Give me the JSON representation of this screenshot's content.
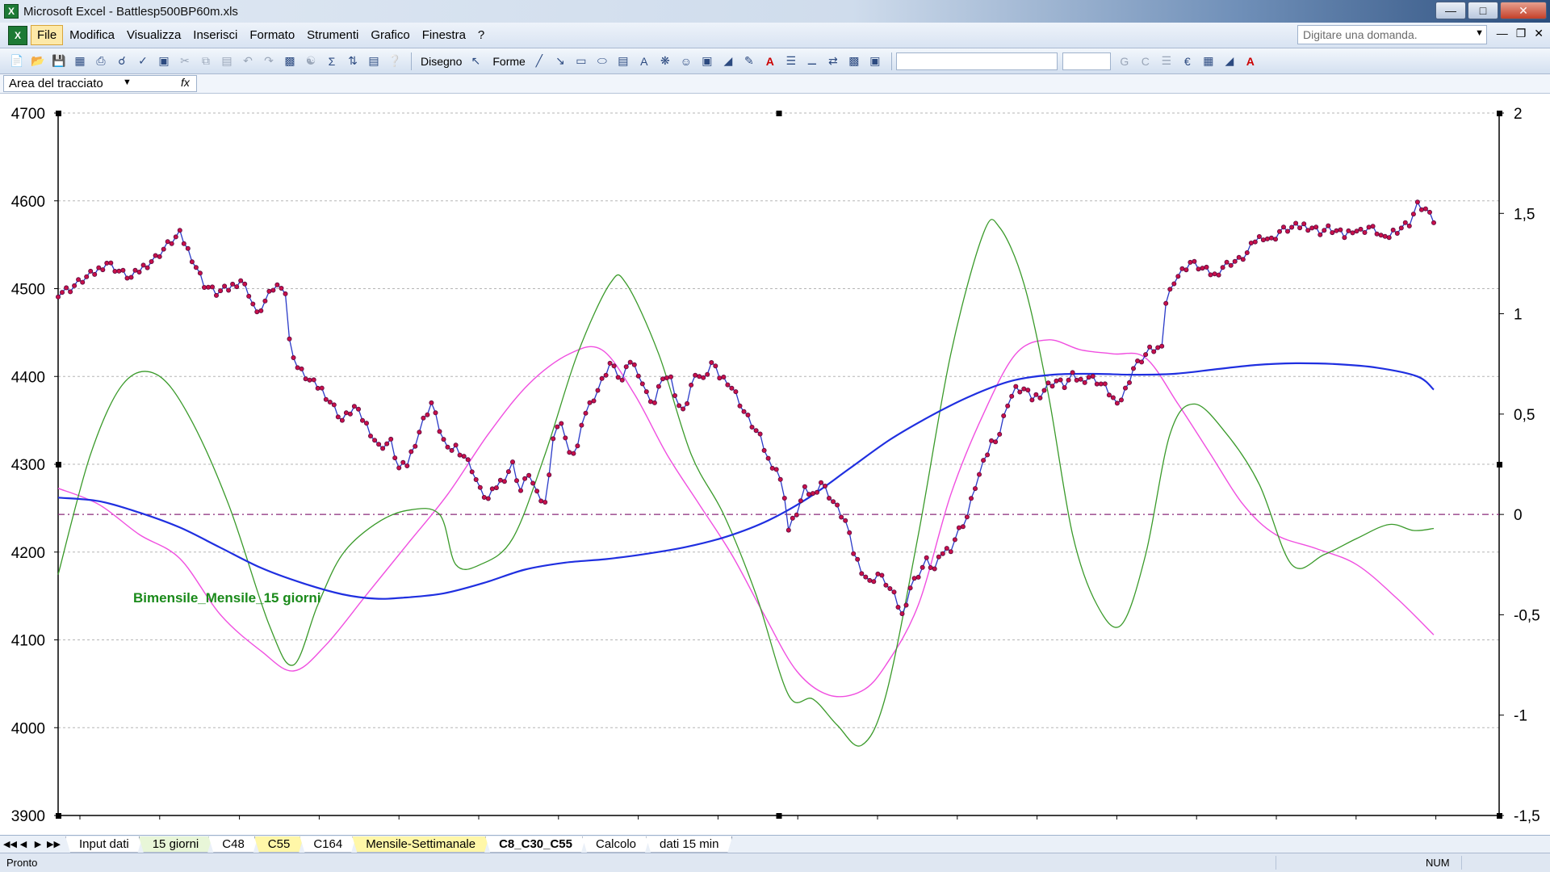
{
  "window": {
    "title": "Microsoft Excel - Battlesp500BP60m.xls",
    "app_icon": "X"
  },
  "menu": {
    "items": [
      "File",
      "Modifica",
      "Visualizza",
      "Inserisci",
      "Formato",
      "Strumenti",
      "Grafico",
      "Finestra",
      "?"
    ],
    "active_index": 0,
    "ask_placeholder": "Digitare una domanda."
  },
  "toolbar": {
    "draw_label": "Disegno",
    "shapes_label": "Forme",
    "bold_label": "G",
    "italic_label": "C",
    "currency_label": "€"
  },
  "namebox": {
    "value": "Area del tracciato",
    "fx": "fx"
  },
  "sheets": {
    "tabs": [
      {
        "label": "Input dati",
        "style": "plain"
      },
      {
        "label": "15 giorni",
        "style": "green"
      },
      {
        "label": "C48",
        "style": "plain"
      },
      {
        "label": "C55",
        "style": "yellow"
      },
      {
        "label": "C164",
        "style": "plain"
      },
      {
        "label": "Mensile-Settimanale",
        "style": "yellow"
      },
      {
        "label": "C8_C30_C55",
        "style": "active"
      },
      {
        "label": "Calcolo",
        "style": "plain"
      },
      {
        "label": "dati 15 min",
        "style": "plain"
      }
    ]
  },
  "status": {
    "text": "Pronto",
    "num": "NUM"
  },
  "chart_data": {
    "type": "line",
    "annotation": "Bimensile_Mensile_15 giorni",
    "grid": true,
    "y_left": {
      "min": 3900,
      "max": 4700,
      "ticks": [
        "4700",
        "4600",
        "4500",
        "4400",
        "4300",
        "4200",
        "4100",
        "4000",
        "3900"
      ]
    },
    "y_right": {
      "min": -1.5,
      "max": 2,
      "ticks": [
        "2",
        "1,5",
        "1",
        "0,5",
        "0",
        "-0,5",
        "-1",
        "-1,5"
      ]
    },
    "colors": {
      "price": "#7b1f6e",
      "price_markers": "#c8104a",
      "blue": "#1f2fe0",
      "green": "#3a9a2a",
      "magenta": "#f04fe0",
      "zero_line": "#8a2a7a",
      "annotation": "#1a8a1a"
    },
    "price": {
      "axis": "left",
      "anchors": [
        [
          0,
          4495
        ],
        [
          3,
          4500
        ],
        [
          6,
          4510
        ],
        [
          9,
          4518
        ],
        [
          12,
          4530
        ],
        [
          15,
          4520
        ],
        [
          18,
          4512
        ],
        [
          21,
          4525
        ],
        [
          24,
          4535
        ],
        [
          27,
          4550
        ],
        [
          30,
          4562
        ],
        [
          33,
          4535
        ],
        [
          36,
          4505
        ],
        [
          39,
          4495
        ],
        [
          42,
          4500
        ],
        [
          45,
          4510
        ],
        [
          47,
          4495
        ],
        [
          49,
          4470
        ],
        [
          51,
          4485
        ],
        [
          53,
          4500
        ],
        [
          55,
          4505
        ],
        [
          56,
          4495
        ],
        [
          57,
          4440
        ],
        [
          59,
          4410
        ],
        [
          62,
          4395
        ],
        [
          65,
          4385
        ],
        [
          68,
          4365
        ],
        [
          70,
          4350
        ],
        [
          73,
          4365
        ],
        [
          76,
          4345
        ],
        [
          79,
          4320
        ],
        [
          82,
          4325
        ],
        [
          84,
          4295
        ],
        [
          86,
          4300
        ],
        [
          88,
          4325
        ],
        [
          90,
          4350
        ],
        [
          92,
          4370
        ],
        [
          94,
          4340
        ],
        [
          96,
          4315
        ],
        [
          98,
          4320
        ],
        [
          100,
          4310
        ],
        [
          102,
          4295
        ],
        [
          104,
          4270
        ],
        [
          106,
          4260
        ],
        [
          108,
          4275
        ],
        [
          110,
          4285
        ],
        [
          112,
          4300
        ],
        [
          114,
          4270
        ],
        [
          116,
          4290
        ],
        [
          118,
          4265
        ],
        [
          120,
          4255
        ],
        [
          122,
          4330
        ],
        [
          124,
          4350
        ],
        [
          126,
          4310
        ],
        [
          128,
          4320
        ],
        [
          130,
          4360
        ],
        [
          133,
          4385
        ],
        [
          136,
          4415
        ],
        [
          139,
          4395
        ],
        [
          141,
          4418
        ],
        [
          143,
          4405
        ],
        [
          145,
          4380
        ],
        [
          147,
          4370
        ],
        [
          149,
          4400
        ],
        [
          151,
          4395
        ],
        [
          153,
          4365
        ],
        [
          155,
          4370
        ],
        [
          157,
          4405
        ],
        [
          159,
          4395
        ],
        [
          161,
          4415
        ],
        [
          163,
          4400
        ],
        [
          165,
          4395
        ],
        [
          167,
          4380
        ],
        [
          169,
          4360
        ],
        [
          171,
          4345
        ],
        [
          173,
          4330
        ],
        [
          175,
          4305
        ],
        [
          177,
          4295
        ],
        [
          179,
          4265
        ],
        [
          180,
          4225
        ],
        [
          182,
          4245
        ],
        [
          184,
          4270
        ],
        [
          186,
          4265
        ],
        [
          188,
          4280
        ],
        [
          190,
          4265
        ],
        [
          192,
          4250
        ],
        [
          194,
          4235
        ],
        [
          196,
          4200
        ],
        [
          198,
          4180
        ],
        [
          200,
          4165
        ],
        [
          202,
          4175
        ],
        [
          204,
          4165
        ],
        [
          206,
          4150
        ],
        [
          208,
          4128
        ],
        [
          210,
          4160
        ],
        [
          212,
          4175
        ],
        [
          214,
          4190
        ],
        [
          216,
          4180
        ],
        [
          218,
          4200
        ],
        [
          220,
          4205
        ],
        [
          222,
          4225
        ],
        [
          224,
          4240
        ],
        [
          226,
          4275
        ],
        [
          228,
          4300
        ],
        [
          230,
          4325
        ],
        [
          232,
          4335
        ],
        [
          234,
          4370
        ],
        [
          236,
          4385
        ],
        [
          238,
          4385
        ],
        [
          240,
          4375
        ],
        [
          242,
          4380
        ],
        [
          244,
          4390
        ],
        [
          246,
          4395
        ],
        [
          248,
          4390
        ],
        [
          250,
          4400
        ],
        [
          252,
          4395
        ],
        [
          254,
          4400
        ],
        [
          256,
          4395
        ],
        [
          258,
          4388
        ],
        [
          260,
          4375
        ],
        [
          261,
          4365
        ],
        [
          263,
          4385
        ],
        [
          265,
          4410
        ],
        [
          267,
          4420
        ],
        [
          269,
          4430
        ],
        [
          271,
          4432
        ],
        [
          272,
          4430
        ],
        [
          273,
          4485
        ],
        [
          275,
          4510
        ],
        [
          277,
          4520
        ],
        [
          279,
          4530
        ],
        [
          281,
          4525
        ],
        [
          283,
          4520
        ],
        [
          285,
          4515
        ],
        [
          287,
          4525
        ],
        [
          289,
          4530
        ],
        [
          291,
          4532
        ],
        [
          293,
          4540
        ],
        [
          295,
          4555
        ],
        [
          297,
          4560
        ],
        [
          299,
          4555
        ],
        [
          301,
          4565
        ],
        [
          303,
          4568
        ],
        [
          305,
          4570
        ],
        [
          307,
          4572
        ],
        [
          309,
          4570
        ],
        [
          311,
          4565
        ],
        [
          313,
          4568
        ],
        [
          315,
          4565
        ],
        [
          317,
          4560
        ],
        [
          319,
          4568
        ],
        [
          321,
          4565
        ],
        [
          323,
          4570
        ],
        [
          325,
          4565
        ],
        [
          327,
          4555
        ],
        [
          329,
          4565
        ],
        [
          331,
          4570
        ],
        [
          333,
          4575
        ],
        [
          335,
          4595
        ],
        [
          337,
          4590
        ],
        [
          339,
          4575
        ]
      ]
    },
    "blue_series": {
      "axis": "left",
      "anchors": [
        [
          0,
          4262
        ],
        [
          10,
          4258
        ],
        [
          20,
          4245
        ],
        [
          30,
          4228
        ],
        [
          40,
          4205
        ],
        [
          50,
          4182
        ],
        [
          60,
          4165
        ],
        [
          70,
          4152
        ],
        [
          78,
          4147
        ],
        [
          85,
          4148
        ],
        [
          95,
          4153
        ],
        [
          105,
          4165
        ],
        [
          115,
          4180
        ],
        [
          125,
          4188
        ],
        [
          135,
          4192
        ],
        [
          145,
          4198
        ],
        [
          155,
          4206
        ],
        [
          165,
          4218
        ],
        [
          175,
          4236
        ],
        [
          185,
          4262
        ],
        [
          195,
          4295
        ],
        [
          205,
          4328
        ],
        [
          215,
          4355
        ],
        [
          225,
          4378
        ],
        [
          235,
          4395
        ],
        [
          245,
          4402
        ],
        [
          255,
          4403
        ],
        [
          265,
          4402
        ],
        [
          275,
          4403
        ],
        [
          285,
          4408
        ],
        [
          295,
          4413
        ],
        [
          305,
          4415
        ],
        [
          315,
          4414
        ],
        [
          325,
          4410
        ],
        [
          335,
          4400
        ],
        [
          339,
          4385
        ]
      ]
    },
    "green_series": {
      "axis": "right",
      "anchors": [
        [
          0,
          -0.3
        ],
        [
          8,
          0.3
        ],
        [
          16,
          0.65
        ],
        [
          24,
          0.7
        ],
        [
          32,
          0.5
        ],
        [
          42,
          0.05
        ],
        [
          52,
          -0.55
        ],
        [
          58,
          -0.75
        ],
        [
          64,
          -0.45
        ],
        [
          70,
          -0.2
        ],
        [
          78,
          -0.05
        ],
        [
          86,
          0.02
        ],
        [
          94,
          0.0
        ],
        [
          98,
          -0.25
        ],
        [
          104,
          -0.25
        ],
        [
          112,
          -0.12
        ],
        [
          120,
          0.3
        ],
        [
          128,
          0.8
        ],
        [
          136,
          1.15
        ],
        [
          140,
          1.15
        ],
        [
          148,
          0.8
        ],
        [
          156,
          0.3
        ],
        [
          164,
          0.0
        ],
        [
          172,
          -0.4
        ],
        [
          180,
          -0.9
        ],
        [
          186,
          -0.92
        ],
        [
          192,
          -1.05
        ],
        [
          198,
          -1.15
        ],
        [
          204,
          -0.9
        ],
        [
          212,
          -0.1
        ],
        [
          220,
          0.8
        ],
        [
          228,
          1.4
        ],
        [
          232,
          1.43
        ],
        [
          238,
          1.15
        ],
        [
          244,
          0.6
        ],
        [
          250,
          -0.1
        ],
        [
          256,
          -0.45
        ],
        [
          262,
          -0.55
        ],
        [
          268,
          -0.2
        ],
        [
          274,
          0.4
        ],
        [
          280,
          0.55
        ],
        [
          288,
          0.4
        ],
        [
          296,
          0.15
        ],
        [
          304,
          -0.25
        ],
        [
          312,
          -0.2
        ],
        [
          320,
          -0.12
        ],
        [
          328,
          -0.05
        ],
        [
          334,
          -0.08
        ],
        [
          339,
          -0.07
        ]
      ]
    },
    "magenta_series": {
      "axis": "right",
      "anchors": [
        [
          0,
          0.13
        ],
        [
          10,
          0.05
        ],
        [
          20,
          -0.1
        ],
        [
          30,
          -0.22
        ],
        [
          40,
          -0.5
        ],
        [
          50,
          -0.68
        ],
        [
          58,
          -0.78
        ],
        [
          66,
          -0.65
        ],
        [
          76,
          -0.4
        ],
        [
          86,
          -0.15
        ],
        [
          96,
          0.1
        ],
        [
          106,
          0.4
        ],
        [
          116,
          0.65
        ],
        [
          126,
          0.8
        ],
        [
          134,
          0.82
        ],
        [
          142,
          0.6
        ],
        [
          150,
          0.3
        ],
        [
          158,
          0.05
        ],
        [
          166,
          -0.2
        ],
        [
          174,
          -0.5
        ],
        [
          182,
          -0.78
        ],
        [
          190,
          -0.9
        ],
        [
          198,
          -0.88
        ],
        [
          204,
          -0.75
        ],
        [
          212,
          -0.45
        ],
        [
          220,
          0.1
        ],
        [
          228,
          0.5
        ],
        [
          236,
          0.8
        ],
        [
          244,
          0.87
        ],
        [
          252,
          0.82
        ],
        [
          260,
          0.8
        ],
        [
          268,
          0.78
        ],
        [
          276,
          0.55
        ],
        [
          284,
          0.3
        ],
        [
          292,
          0.05
        ],
        [
          300,
          -0.1
        ],
        [
          310,
          -0.17
        ],
        [
          320,
          -0.25
        ],
        [
          330,
          -0.42
        ],
        [
          339,
          -0.6
        ]
      ]
    }
  }
}
